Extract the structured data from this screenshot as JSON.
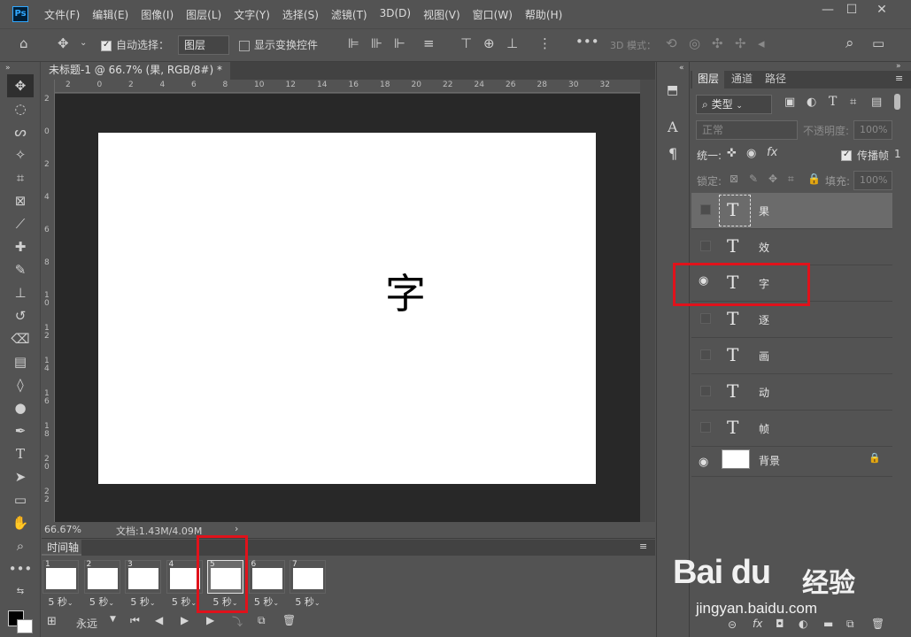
{
  "app": {
    "logo": "Ps"
  },
  "menu": [
    "文件(F)",
    "编辑(E)",
    "图像(I)",
    "图层(L)",
    "文字(Y)",
    "选择(S)",
    "滤镜(T)",
    "3D(D)",
    "视图(V)",
    "窗口(W)",
    "帮助(H)"
  ],
  "window_controls": {
    "minimize": "—",
    "restore": "☐",
    "close": "✕"
  },
  "options": {
    "auto_select_label": "自动选择：",
    "auto_select_value": "图层",
    "show_transform_label": "显示变换控件",
    "mode_3d_label": "3D 模式："
  },
  "document": {
    "tab_title": "未标题-1 @ 66.7% (果, RGB/8#) *",
    "canvas_text": "字",
    "zoom": "66.67%",
    "doc_info": "文档:1.43M/4.09M",
    "ruler_top": [
      "2",
      "0",
      "2",
      "4",
      "6",
      "8",
      "10",
      "12",
      "14",
      "16",
      "18",
      "20",
      "22",
      "24",
      "26",
      "28",
      "30",
      "32"
    ],
    "ruler_left": [
      "2",
      "0",
      "2",
      "4",
      "6",
      "8",
      "1\n0",
      "1\n2",
      "1\n4",
      "1\n6",
      "1\n8",
      "2\n0",
      "2\n2"
    ]
  },
  "timeline": {
    "tab_label": "时间轴",
    "frames": [
      {
        "num": "1",
        "delay": "5 秒"
      },
      {
        "num": "2",
        "delay": "5 秒"
      },
      {
        "num": "3",
        "delay": "5 秒"
      },
      {
        "num": "4",
        "delay": "5 秒"
      },
      {
        "num": "5",
        "delay": "5 秒"
      },
      {
        "num": "6",
        "delay": "5 秒"
      },
      {
        "num": "7",
        "delay": "5 秒"
      }
    ],
    "loop_label": "永远"
  },
  "layers_panel": {
    "tabs": [
      "图层",
      "通道",
      "路径"
    ],
    "filter_label": "类型",
    "blend_mode": "正常",
    "opacity_label": "不透明度:",
    "opacity_value": "100%",
    "unify_label": "统一:",
    "propagate_label": "传播帧",
    "propagate_value": "1",
    "lock_label": "锁定:",
    "fill_label": "填充:",
    "fill_value": "100%",
    "layers": [
      {
        "name": "果",
        "type": "T",
        "visible": false
      },
      {
        "name": "效",
        "type": "T",
        "visible": false
      },
      {
        "name": "字",
        "type": "T",
        "visible": true
      },
      {
        "name": "逐",
        "type": "T",
        "visible": false
      },
      {
        "name": "画",
        "type": "T",
        "visible": false
      },
      {
        "name": "动",
        "type": "T",
        "visible": false
      },
      {
        "name": "帧",
        "type": "T",
        "visible": false
      },
      {
        "name": "背景",
        "type": "image",
        "visible": true
      }
    ]
  },
  "watermark": {
    "logo": "Bai du",
    "cn": "经验",
    "url": "jingyan.baidu.com"
  }
}
